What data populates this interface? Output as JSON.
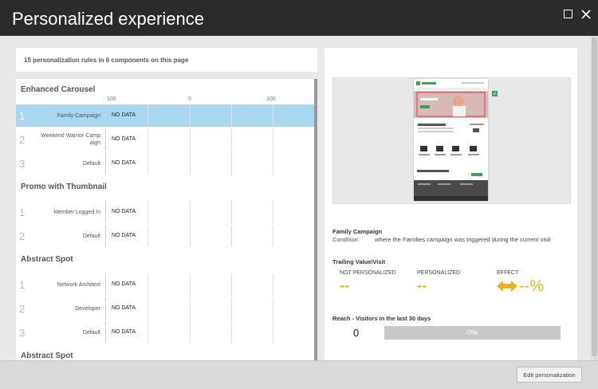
{
  "window": {
    "title": "Personalized experience"
  },
  "summary": "15 personalization rules in 6 components on this page",
  "axis": {
    "left": "100",
    "center": "0",
    "right": "100"
  },
  "components": [
    {
      "title": "Enhanced Carousel",
      "rules": [
        {
          "num": "1",
          "name": "Family Campaign",
          "value": "NO DATA",
          "selected": true
        },
        {
          "num": "2",
          "name": "Weekend Warrior Camp aign",
          "value": "NO DATA"
        },
        {
          "num": "3",
          "name": "Default",
          "value": "NO DATA"
        }
      ]
    },
    {
      "title": "Promo with Thumbnail",
      "rules": [
        {
          "num": "1",
          "name": "Member Logged In",
          "value": "NO DATA"
        },
        {
          "num": "2",
          "name": "Default",
          "value": "NO DATA"
        }
      ]
    },
    {
      "title": "Abstract Spot",
      "rules": [
        {
          "num": "1",
          "name": "Network Architect",
          "value": "NO DATA"
        },
        {
          "num": "2",
          "name": "Developer",
          "value": "NO DATA"
        },
        {
          "num": "3",
          "name": "Default",
          "value": "NO DATA"
        }
      ]
    },
    {
      "title": "Abstract Spot",
      "rules": []
    }
  ],
  "details": {
    "rule_name": "Family Campaign",
    "condition_label": "Condition:",
    "condition_text": "where the Families campaign was triggered during the current visit",
    "trailing_title": "Trailing Value/Visit",
    "not_personalized_label": "NOT PERSONALIZED",
    "not_personalized_value": "--",
    "personalized_label": "PERSONALIZED",
    "personalized_value": "--",
    "effect_label": "EFFECT",
    "effect_value": "--%",
    "reach_title": "Reach - Visitors in the last 30 days",
    "reach_count": "0",
    "reach_percent": "0%",
    "reach_fraction": 0
  },
  "footer": {
    "edit_label": "Edit personalization"
  },
  "colors": {
    "titlebar": "#2b2b2b",
    "selected_row": "#a9d7ef",
    "accent": "#e8b225",
    "preview_green": "#3aa35a"
  },
  "icons": [
    "maximize-icon",
    "close-icon",
    "double-arrow-icon"
  ]
}
